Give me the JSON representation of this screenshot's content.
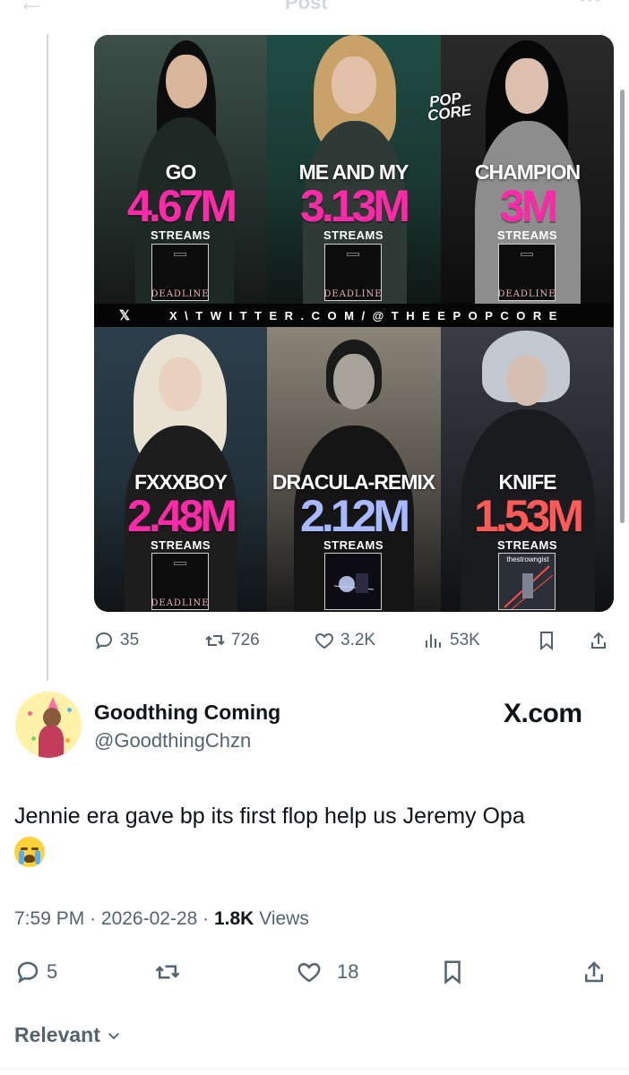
{
  "header": {
    "title": "Post"
  },
  "media": {
    "watermark": "POP CORE",
    "banner": "X\\TWITTER.COM/@THEEPOPCORE",
    "tiles": [
      {
        "song": "GO",
        "streams": "4.67M",
        "label": "STREAMS",
        "cover_text": "DEADLINE",
        "color": "#ff2aa8"
      },
      {
        "song": "ME AND MY",
        "streams": "3.13M",
        "label": "STREAMS",
        "cover_text": "DEADLINE",
        "color": "#ff2aa8"
      },
      {
        "song": "CHAMPION",
        "streams": "3M",
        "label": "STREAMS",
        "cover_text": "DEADLINE",
        "color": "#ff2aa8"
      },
      {
        "song": "FXXXBOY",
        "streams": "2.48M",
        "label": "STREAMS",
        "cover_text": "DEADLINE",
        "color": "#ff2aa8"
      },
      {
        "song": "DRACULA-REMIX",
        "streams": "2.12M",
        "label": "STREAMS",
        "cover_text": "",
        "color": "#a8b9ff"
      },
      {
        "song": "KNIFE",
        "streams": "1.53M",
        "label": "STREAMS",
        "cover_text": "thestrowngist",
        "color": "#ff5a5a"
      }
    ]
  },
  "quoted_actions": {
    "replies": "35",
    "reposts": "726",
    "likes": "3.2K",
    "views": "53K"
  },
  "post": {
    "display_name": "Goodthing Coming",
    "username": "@GoodthingChzn",
    "source": "X.com",
    "text": "Jennie era gave bp its first flop help us Jeremy Opa",
    "emoji": "loudly-crying-face",
    "time": "7:59 PM",
    "date": "2026-02-28",
    "views_count": "1.8K",
    "views_label": "Views"
  },
  "actions": {
    "replies": "5",
    "reposts": "",
    "likes": "18"
  },
  "sort": {
    "label": "Relevant"
  }
}
